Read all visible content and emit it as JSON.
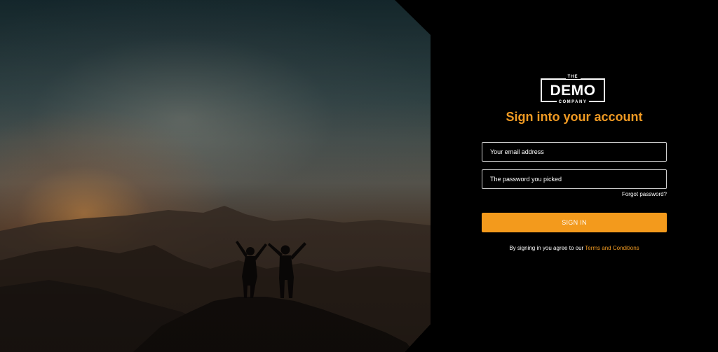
{
  "hero": {
    "image": "mountain-sunset-two-people-celebrating"
  },
  "brand": {
    "logo_top": "THE",
    "logo_main": "DEMO",
    "logo_bottom": "COMPANY"
  },
  "login": {
    "title": "Sign into your account",
    "email_placeholder": "Your email address",
    "password_placeholder": "The password you picked",
    "forgot_label": "Forgot password?",
    "signin_label": "SIGN IN",
    "terms_prefix": "By signing in you agree to our",
    "terms_link": "Terms and Conditions"
  },
  "colors": {
    "accent": "#f39a1c",
    "background": "#000000",
    "text": "#ffffff"
  }
}
